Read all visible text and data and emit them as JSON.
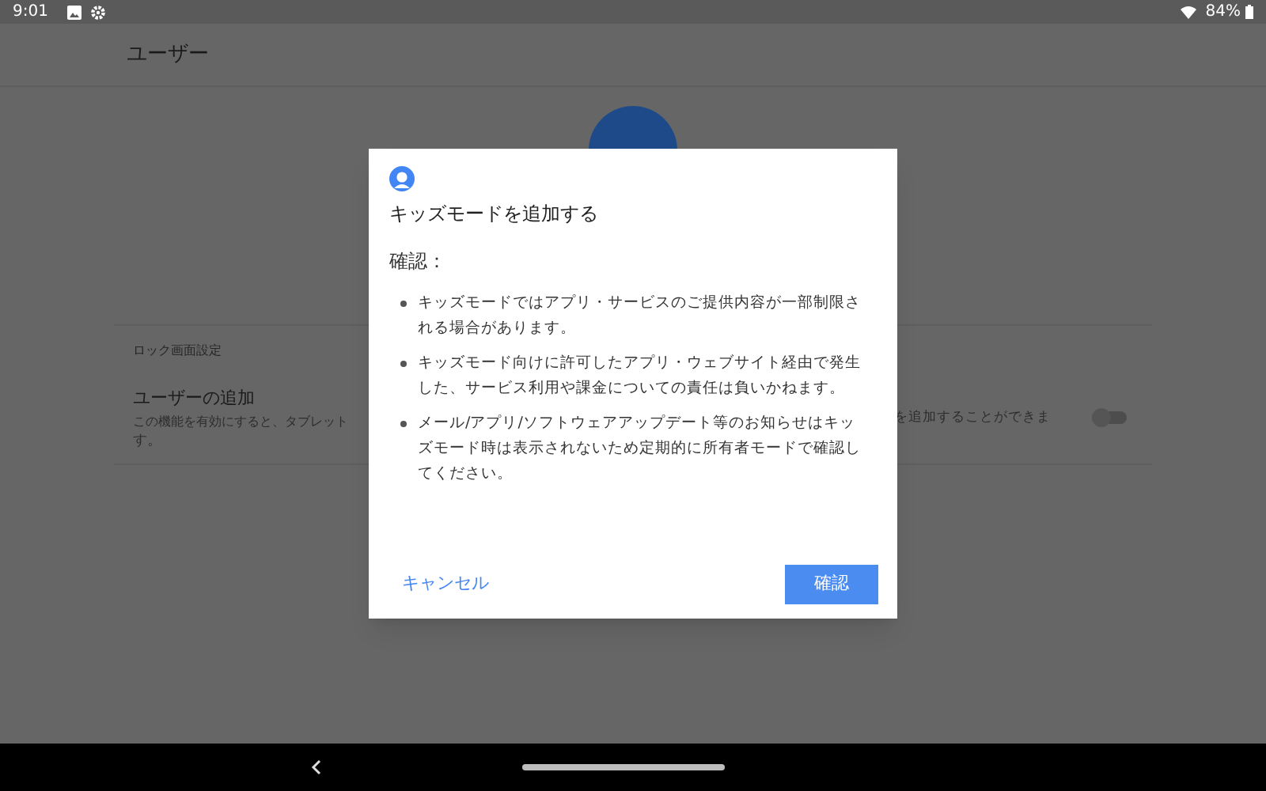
{
  "status_bar": {
    "time": "9:01",
    "battery": "84%"
  },
  "app_bar": {
    "title": "ユーザー"
  },
  "settings": {
    "section_header": "ロック画面設定",
    "row": {
      "title": "ユーザーの追加",
      "description_left_line_1": "この機能を有効にすると、タブレット",
      "description_left_line_2": "す。",
      "description_right": "を追加することができま",
      "toggle": {
        "on": false
      }
    }
  },
  "dialog": {
    "title": "キッズモードを追加する",
    "heading": "確認：",
    "bullets": [
      "キッズモードではアプリ・サービスのご提供内容が一部制限される場合があります。",
      "キッズモード向けに許可したアプリ・ウェブサイト経由で発生した、サービス利用や課金についての責任は負いかねます。",
      "メール/アプリ/ソフトウェアアップデート等のお知らせはキッズモード時は表示されないため定期的に所有者モードで確認してください。"
    ],
    "cancel_button": "キャンセル",
    "confirm_button": "確認"
  }
}
